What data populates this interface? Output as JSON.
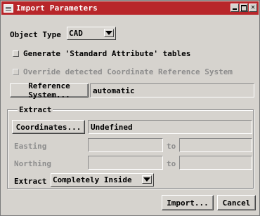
{
  "window": {
    "title": "Import Parameters"
  },
  "object_type": {
    "label": "Object Type",
    "value": "CAD"
  },
  "generate_tables": {
    "label": "Generate 'Standard Attribute' tables",
    "checked": false
  },
  "override_crs": {
    "label": "Override detected Coordinate Reference System",
    "checked": false,
    "enabled": false
  },
  "reference_system": {
    "button_label": "Reference System...",
    "value": "automatic"
  },
  "extract_group": {
    "title": "Extract",
    "coordinates_button": "Coordinates...",
    "coordinates_value": "Undefined",
    "easting_label": "Easting",
    "northing_label": "Northing",
    "to_label": "to",
    "extract_label": "Extract",
    "extract_mode": "Completely Inside"
  },
  "buttons": {
    "import": "Import...",
    "cancel": "Cancel"
  }
}
